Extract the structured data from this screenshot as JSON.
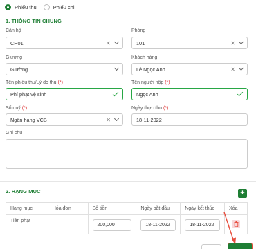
{
  "receipt_type": {
    "options": [
      {
        "label": "Phiếu thu",
        "checked": true
      },
      {
        "label": "Phiếu chi",
        "checked": false
      }
    ]
  },
  "general": {
    "section_title": "1. THÔNG TIN CHUNG",
    "apartment": {
      "label": "Căn hộ",
      "value": "CH01"
    },
    "room": {
      "label": "Phòng",
      "value": "101"
    },
    "bed": {
      "label": "Giường",
      "value": "Giường"
    },
    "customer": {
      "label": "Khách hàng",
      "value": "Lê Ngọc Anh"
    },
    "receipt_name": {
      "label": "Tên phiếu thu/Lý do thu",
      "required": "(*)",
      "value": "Phí phạt vệ sinh"
    },
    "payer_name": {
      "label": "Tên người nộp",
      "required": "(*)",
      "value": "Ngọc Anh"
    },
    "fund": {
      "label": "Sổ quỹ",
      "required": "(*)",
      "value": "Ngân hàng VCB"
    },
    "actual_date": {
      "label": "Ngày thực thu",
      "required": "(*)",
      "value": "18-11-2022"
    },
    "note": {
      "label": "Ghi chú",
      "value": ""
    }
  },
  "items": {
    "section_title": "2. HẠNG MỤC",
    "add_label": "+",
    "columns": [
      "Hạng mục",
      "Hóa đơn",
      "Số tiền",
      "Ngày bắt đầu",
      "Ngày kết thúc",
      "Xóa"
    ],
    "rows": [
      {
        "category": "Tiền phạt",
        "invoice": "",
        "amount": "200,000",
        "start_date": "18-11-2022",
        "end_date": "18-11-2022"
      }
    ]
  },
  "colors": {
    "accent": "#1e7e34",
    "required": "#dd3333",
    "valid_border": "#28a745",
    "annotation_arrow": "#e74c3c"
  }
}
